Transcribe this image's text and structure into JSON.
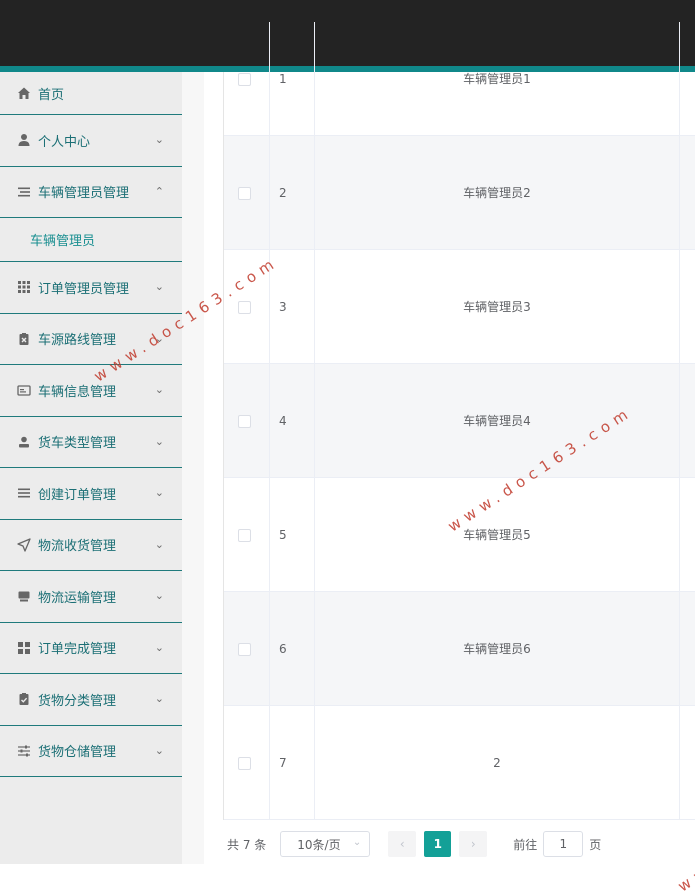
{
  "nav": {
    "home": "首页",
    "personal": "个人中心",
    "vehicle_admin": "车辆管理员管理",
    "vehicle_admin_sub": "车辆管理员",
    "order_admin": "订单管理员管理",
    "routes": "车源路线管理",
    "vehicle_info": "车辆信息管理",
    "truck_types": "货车类型管理",
    "create_order": "创建订单管理",
    "receiving": "物流收货管理",
    "transport": "物流运输管理",
    "order_complete": "订单完成管理",
    "goods_category": "货物分类管理",
    "warehouse": "货物仓储管理"
  },
  "table": {
    "rows": [
      {
        "idx": "1",
        "name": "车辆管理员1"
      },
      {
        "idx": "2",
        "name": "车辆管理员2"
      },
      {
        "idx": "3",
        "name": "车辆管理员3"
      },
      {
        "idx": "4",
        "name": "车辆管理员4"
      },
      {
        "idx": "5",
        "name": "车辆管理员5"
      },
      {
        "idx": "6",
        "name": "车辆管理员6"
      },
      {
        "idx": "7",
        "name": "2"
      }
    ]
  },
  "pagination": {
    "total": "共 7 条",
    "page_size": "10条/页",
    "current": "1",
    "goto_label": "前往",
    "goto_value": "1",
    "page_unit": "页"
  },
  "watermark": "www.doc163.com",
  "colors": {
    "topbar": "#232323",
    "accent": "#10888a",
    "nav_text": "#1b6f75",
    "active_page": "#13a097",
    "watermark": "#c0392b"
  }
}
